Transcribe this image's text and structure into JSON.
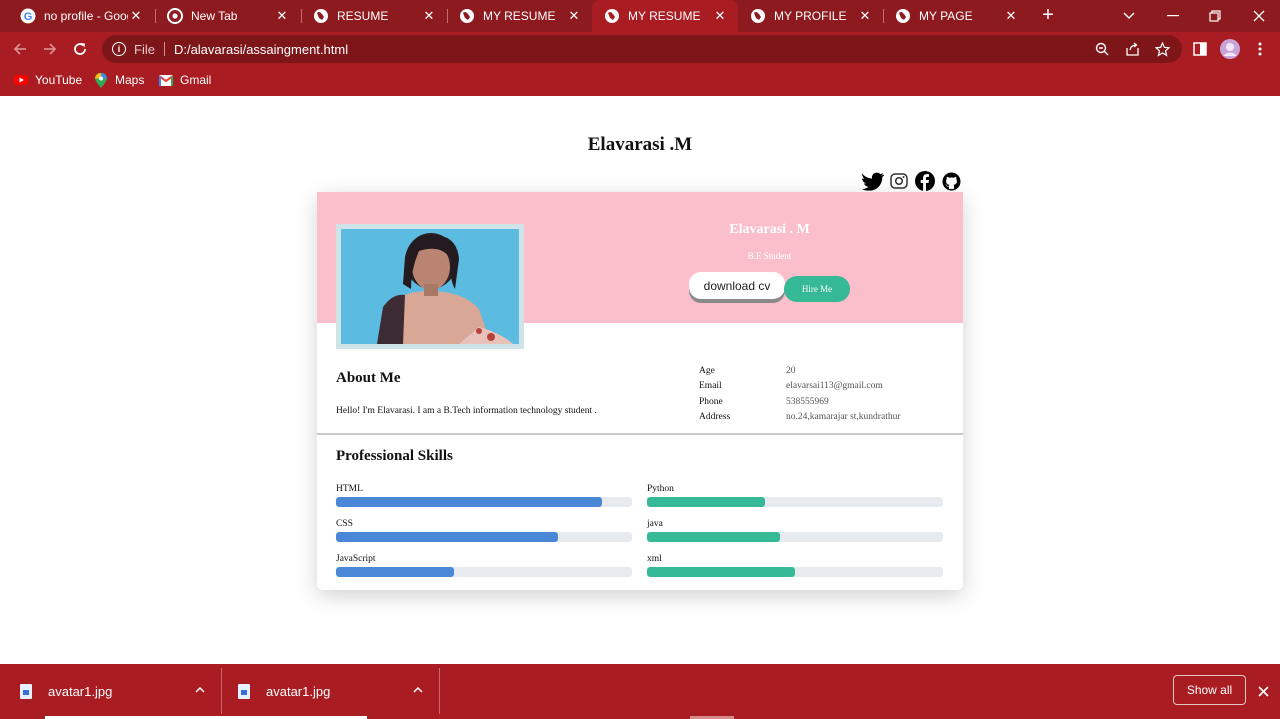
{
  "browser": {
    "tabs": [
      {
        "title": "no profile - Goog",
        "icon": "google-icon",
        "active": false
      },
      {
        "title": "New Tab",
        "icon": "chrome-icon",
        "active": false
      },
      {
        "title": "RESUME",
        "icon": "globe-icon",
        "active": false
      },
      {
        "title": "MY RESUME",
        "icon": "globe-icon",
        "active": false
      },
      {
        "title": "MY RESUME",
        "icon": "globe-icon",
        "active": true
      },
      {
        "title": "MY PROFILE",
        "icon": "globe-icon",
        "active": false
      },
      {
        "title": "MY PAGE",
        "icon": "globe-icon",
        "active": false
      }
    ],
    "close_glyph": "✕",
    "new_tab_glyph": "+",
    "address": {
      "scheme_label": "File",
      "url": "D:/alavarasi/assaingment.html"
    },
    "bookmarks": [
      {
        "label": "YouTube",
        "icon": "youtube-icon"
      },
      {
        "label": "Maps",
        "icon": "maps-pin-icon"
      },
      {
        "label": "Gmail",
        "icon": "gmail-icon"
      }
    ]
  },
  "page": {
    "title": "Elavarasi .M",
    "socials": [
      "twitter-icon",
      "instagram-icon",
      "facebook-icon",
      "github-icon"
    ],
    "hero": {
      "name": "Elavarasi . M",
      "subtitle": "B.E Student",
      "download_label": "download cv",
      "hire_label": "Hire Me"
    },
    "about": {
      "heading": "About Me",
      "text": "Hello! I'm Elavarasi. I am a B.Tech information technology student ."
    },
    "info": [
      {
        "key": "Age",
        "value": "20"
      },
      {
        "key": "Email",
        "value": "elavarsai113@gmail.com"
      },
      {
        "key": "Phone",
        "value": "538555969"
      },
      {
        "key": "Address",
        "value": "no.24,kamarajar st,kundrathur"
      }
    ],
    "skills_heading": "Professional Skills",
    "skills": [
      {
        "name": "HTML",
        "level": 0.9,
        "color": "#4a87d6"
      },
      {
        "name": "Python",
        "level": 0.4,
        "color": "#35b996"
      },
      {
        "name": "CSS",
        "level": 0.75,
        "color": "#4a87d6"
      },
      {
        "name": "java",
        "level": 0.45,
        "color": "#35b996"
      },
      {
        "name": "JavaScript",
        "level": 0.4,
        "color": "#4a87d6"
      },
      {
        "name": "xml",
        "level": 0.5,
        "color": "#35b996"
      }
    ]
  },
  "downloads": {
    "items": [
      {
        "filename": "avatar1.jpg"
      },
      {
        "filename": "avatar1.jpg"
      }
    ],
    "show_all_label": "Show all"
  },
  "colors": {
    "chrome_dark": "#8d1a1e",
    "chrome": "#a81c22",
    "hero_bg": "#fbbfcb",
    "skill_blue": "#4a87d6",
    "skill_green": "#35b996"
  }
}
